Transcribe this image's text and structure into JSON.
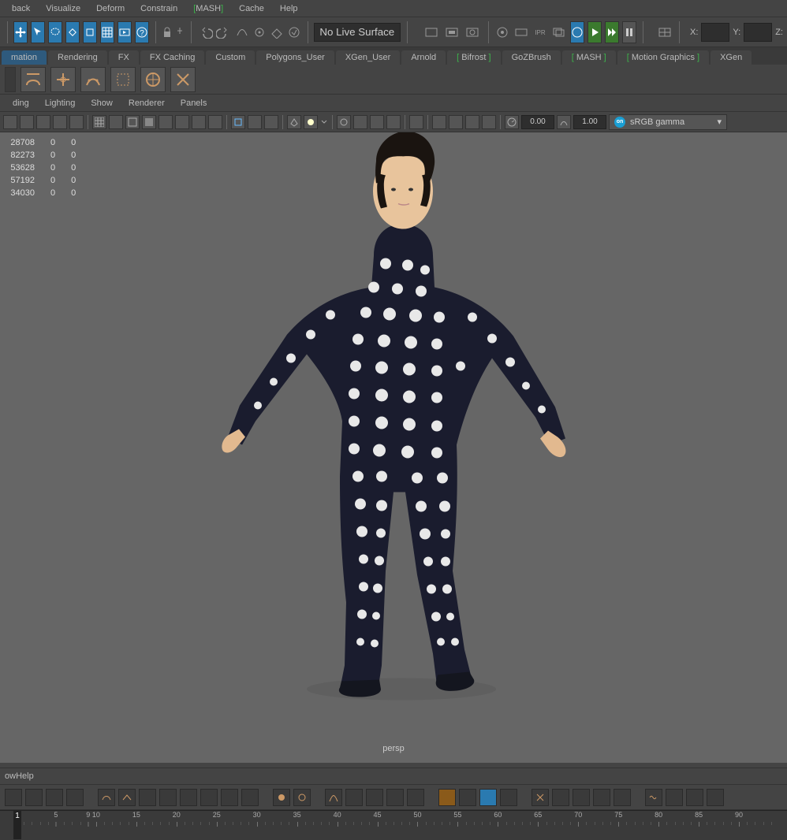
{
  "menubar": {
    "items": [
      "back",
      "Visualize",
      "Deform",
      "Constrain",
      "MASH",
      "Cache",
      "Help"
    ],
    "bracketed": [
      false,
      false,
      false,
      false,
      true,
      false,
      false
    ]
  },
  "toolbar": {
    "liveSurface": "No Live Surface",
    "coords": {
      "x_label": "X:",
      "x_val": "",
      "y_label": "Y:",
      "y_val": "",
      "z_label": "Z:",
      "z_val": ""
    }
  },
  "shelf": {
    "tabs": [
      "mation",
      "Rendering",
      "FX",
      "FX Caching",
      "Custom",
      "Polygons_User",
      "XGen_User",
      "Arnold",
      "Bifrost",
      "GoZBrush",
      "MASH",
      "Motion Graphics",
      "XGen"
    ],
    "bracketed": [
      false,
      false,
      false,
      false,
      false,
      false,
      false,
      false,
      true,
      false,
      true,
      true,
      false
    ]
  },
  "panel": {
    "menu": [
      "ding",
      "Lighting",
      "Show",
      "Renderer",
      "Panels"
    ],
    "exposure": "0.00",
    "gamma": "1.00",
    "colorMode": "sRGB gamma"
  },
  "viewport": {
    "hudRows": [
      [
        "28708",
        "0",
        "0"
      ],
      [
        "82273",
        "0",
        "0"
      ],
      [
        "53628",
        "0",
        "0"
      ],
      [
        "57192",
        "0",
        "0"
      ],
      [
        "34030",
        "0",
        "0"
      ]
    ],
    "camera": "persp"
  },
  "bottom": {
    "menu": [
      "ow",
      "Help"
    ]
  },
  "timeline": {
    "current": "1",
    "ticks": [
      "5",
      "10",
      "15",
      "20",
      "25",
      "30",
      "35",
      "40",
      "45",
      "50",
      "55",
      "60",
      "65",
      "70",
      "75",
      "80",
      "85",
      "90",
      "9"
    ]
  },
  "colors": {
    "accent": "#2a7ab0",
    "green": "#3cb44b"
  }
}
